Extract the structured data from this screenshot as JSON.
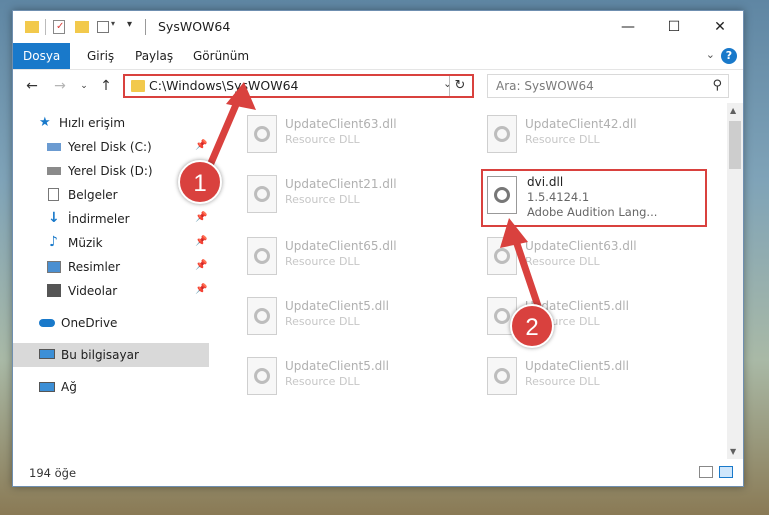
{
  "window": {
    "title": "SysWOW64"
  },
  "ribbon": {
    "tabs": [
      {
        "label": "Dosya",
        "active": true
      },
      {
        "label": "Giriş"
      },
      {
        "label": "Paylaş"
      },
      {
        "label": "Görünüm"
      }
    ],
    "help_label": "?"
  },
  "nav": {
    "address": "C:\\Windows\\SysWOW64",
    "search_placeholder": "Ara: SysWOW64"
  },
  "sidebar": {
    "items": [
      {
        "label": "Hızlı erişim",
        "icon": "star-icon",
        "color": "#1979ca"
      },
      {
        "label": "Yerel Disk (C:)",
        "icon": "drive-icon",
        "color": "#6b9bd1",
        "pinned": true
      },
      {
        "label": "Yerel Disk (D:)",
        "icon": "drive-icon",
        "color": "#6b9bd1"
      },
      {
        "label": "Belgeler",
        "icon": "documents-icon",
        "color": "#7a7a7a"
      },
      {
        "label": "İndirmeler",
        "icon": "download-icon",
        "color": "#1979ca",
        "pinned": true
      },
      {
        "label": "Müzik",
        "icon": "music-icon",
        "color": "#1979ca",
        "pinned": true
      },
      {
        "label": "Resimler",
        "icon": "pictures-icon",
        "color": "#4a8fd1",
        "pinned": true
      },
      {
        "label": "Videolar",
        "icon": "video-icon",
        "color": "#555555",
        "pinned": true
      },
      {
        "label": "OneDrive",
        "icon": "cloud-icon",
        "color": "#1979ca"
      },
      {
        "label": "Bu bilgisayar",
        "icon": "computer-icon",
        "color": "#3c8fd6",
        "selected": true
      },
      {
        "label": "Ağ",
        "icon": "network-icon",
        "color": "#3c8fd6"
      }
    ]
  },
  "files": [
    {
      "name": "UpdateClient63.dll",
      "type": "Resource DLL"
    },
    {
      "name": "UpdateClient42.dll",
      "type": "Resource DLL"
    },
    {
      "name": "UpdateClient21.dll",
      "type": "Resource DLL"
    },
    {
      "name": "dvi.dll",
      "version": "1.5.4124.1",
      "desc": "Adobe Audition Lang...",
      "highlighted": true
    },
    {
      "name": "UpdateClient65.dll",
      "type": "Resource DLL"
    },
    {
      "name": "UpdateClient63.dll",
      "type": "Resource DLL"
    },
    {
      "name": "UpdateClient5.dll",
      "type": "Resource DLL"
    },
    {
      "name": "UpdateClient5.dll",
      "type": "Resource DLL"
    },
    {
      "name": "UpdateClient5.dll",
      "type": "Resource DLL"
    },
    {
      "name": "UpdateClient5.dll",
      "type": "Resource DLL"
    }
  ],
  "status": {
    "count": "194 öğe"
  },
  "callouts": [
    {
      "label": "1"
    },
    {
      "label": "2"
    }
  ],
  "colors": {
    "accent": "#1979ca",
    "highlight": "#d9413e"
  }
}
